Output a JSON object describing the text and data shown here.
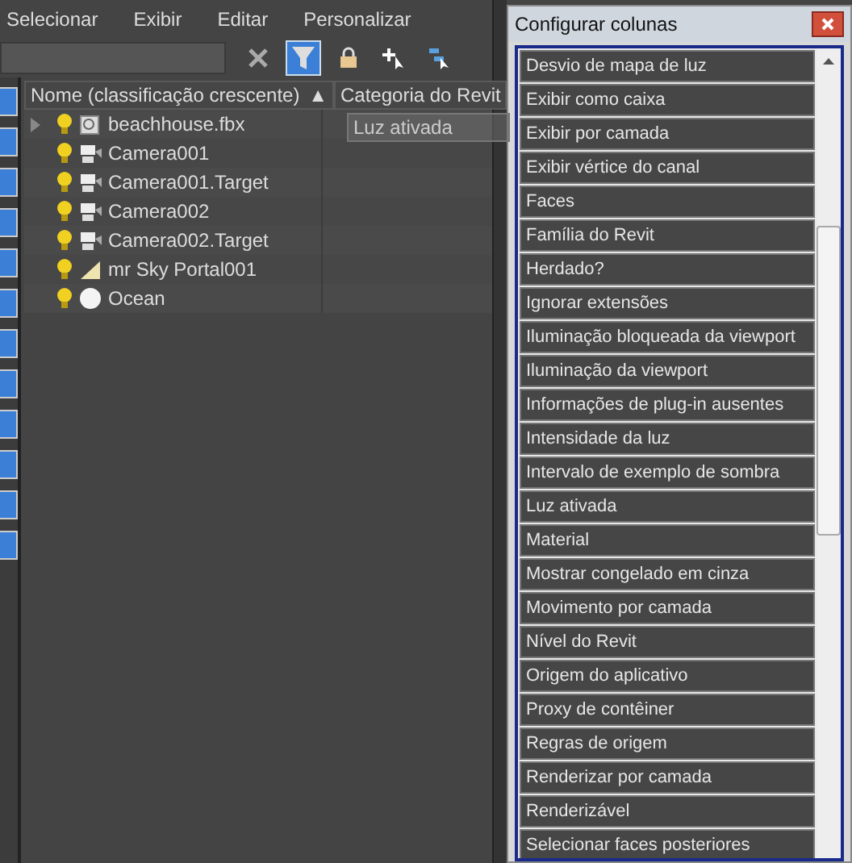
{
  "menu": [
    "Selecionar",
    "Exibir",
    "Editar",
    "Personalizar"
  ],
  "toolbar": {
    "filter_active": true
  },
  "columns": [
    {
      "label": "Nome (classificação crescente)",
      "sort": "▲"
    },
    {
      "label": "Categoria do Revit"
    }
  ],
  "drag_ghost": "Luz ativada",
  "rows": [
    {
      "name": "beachhouse.fbx",
      "kind": "file",
      "expandable": true
    },
    {
      "name": "Camera001",
      "kind": "camera",
      "expandable": false
    },
    {
      "name": "Camera001.Target",
      "kind": "camera",
      "expandable": false
    },
    {
      "name": "Camera002",
      "kind": "camera",
      "expandable": false
    },
    {
      "name": "Camera002.Target",
      "kind": "camera",
      "expandable": false
    },
    {
      "name": "mr Sky Portal001",
      "kind": "light",
      "expandable": false
    },
    {
      "name": "Ocean",
      "kind": "sphere",
      "expandable": false
    }
  ],
  "dialog": {
    "title": "Configurar colunas",
    "items": [
      "Desvio de mapa de luz",
      "Exibir como caixa",
      "Exibir por camada",
      "Exibir vértice do canal",
      "Faces",
      "Família do Revit",
      "Herdado?",
      "Ignorar extensões",
      "Iluminação bloqueada da viewport",
      "Iluminação da viewport",
      "Informações de plug-in ausentes",
      "Intensidade da luz",
      "Intervalo de exemplo de sombra",
      "Luz ativada",
      "Material",
      "Mostrar congelado em cinza",
      "Movimento por camada",
      "Nível do Revit",
      "Origem do aplicativo",
      "Proxy de contêiner",
      "Regras de origem",
      "Renderizar por camada",
      "Renderizável",
      "Selecionar faces posteriores"
    ]
  }
}
